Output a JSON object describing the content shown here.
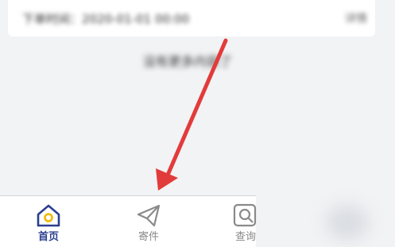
{
  "top_card": {
    "text": "下单时间：2020-01-01 00:00",
    "right_text": "详情"
  },
  "center_hint": "没有更多内容了",
  "bottom_nav": [
    {
      "label": "首页",
      "icon": "home-icon",
      "active": true
    },
    {
      "label": "寄件",
      "icon": "send-icon",
      "active": false
    },
    {
      "label": "查询",
      "icon": "search-icon",
      "active": false
    }
  ],
  "colors": {
    "active": "#2b3f8f",
    "active_dot": "#f2b705",
    "inactive": "#888888",
    "annotation_arrow": "#e23b3b"
  }
}
